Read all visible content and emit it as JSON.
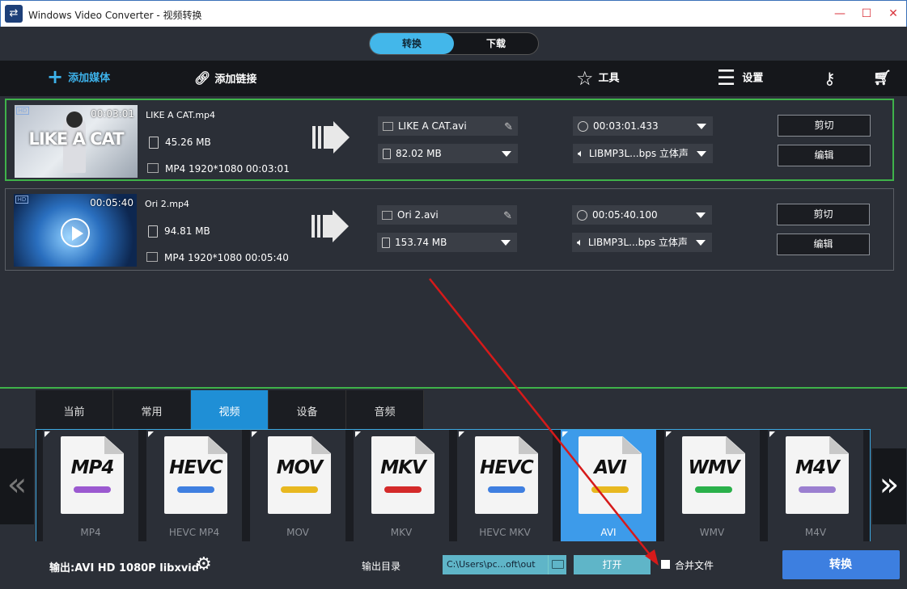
{
  "window": {
    "title": "Windows Video Converter - 视频转换",
    "controls": [
      "minimize",
      "maximize",
      "close"
    ]
  },
  "mode_tabs": {
    "convert": "转换",
    "download": "下载",
    "active": "convert"
  },
  "toolbar": {
    "add_media": "添加媒体",
    "add_link": "添加链接",
    "tools": "工具",
    "settings": "设置"
  },
  "files": [
    {
      "duration_badge": "00:03:01",
      "thumb_text": "LIKE A CAT",
      "name": "LIKE A CAT.mp4",
      "size": "45.26 MB",
      "meta": "MP4 1920*1080 00:03:01",
      "out_name": "LIKE A CAT.avi",
      "out_size": "82.02 MB",
      "out_duration": "00:03:01.433",
      "audio": "LIBMP3L...bps 立体声",
      "cut": "剪切",
      "edit": "编辑",
      "selected": true
    },
    {
      "duration_badge": "00:05:40",
      "thumb_text": "",
      "name": "Ori 2.mp4",
      "size": "94.81 MB",
      "meta": "MP4 1920*1080 00:05:40",
      "out_name": "Ori 2.avi",
      "out_size": "153.74 MB",
      "out_duration": "00:05:40.100",
      "audio": "LIBMP3L...bps 立体声",
      "cut": "剪切",
      "edit": "编辑",
      "selected": false
    }
  ],
  "category_tabs": [
    "当前",
    "常用",
    "视频",
    "设备",
    "音频"
  ],
  "active_category": "视频",
  "formats": [
    {
      "code": "MP4",
      "label": "MP4",
      "pill": "#9b59d0"
    },
    {
      "code": "HEVC",
      "label": "HEVC MP4",
      "pill": "#3f7fe0"
    },
    {
      "code": "MOV",
      "label": "MOV",
      "pill": "#e8b820"
    },
    {
      "code": "MKV",
      "label": "MKV",
      "pill": "#d42a2a"
    },
    {
      "code": "HEVC",
      "label": "HEVC MKV",
      "pill": "#3f7fe0"
    },
    {
      "code": "AVI",
      "label": "AVI",
      "pill": "#e8b820"
    },
    {
      "code": "WMV",
      "label": "WMV",
      "pill": "#2ab04a"
    },
    {
      "code": "M4V",
      "label": "M4V",
      "pill": "#9b7fd0"
    }
  ],
  "active_format": "AVI",
  "bottom": {
    "output": "输出:AVI HD 1080P libxvid",
    "outdir_label": "输出目录",
    "outdir_value": "C:\\Users\\pc...oft\\out",
    "open": "打开",
    "merge": "合并文件",
    "convert": "转换"
  },
  "colors": {
    "accent": "#43b7ea",
    "selected_border": "#3fb24a",
    "convert_button": "#3d7fe0",
    "annotation_arrow": "#d61a1a"
  }
}
